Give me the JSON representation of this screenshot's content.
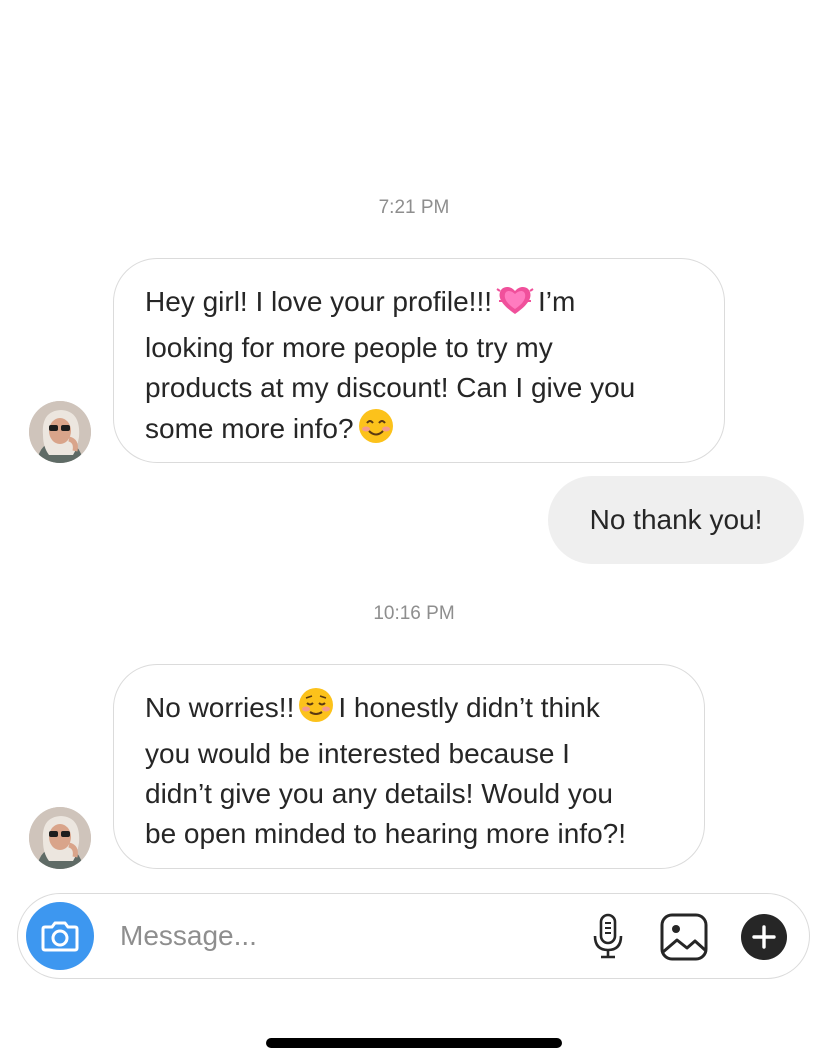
{
  "conversation": {
    "messages": [
      {
        "type": "timestamp",
        "text": "7:21 PM"
      },
      {
        "type": "incoming",
        "lines": [
          "Hey girl! I love your profile!!!",
          "I’m",
          "looking for more people to try my",
          "products at my discount! Can I give you",
          "some more info?"
        ],
        "emojis": [
          "growing-heart-emoji",
          "smiling-face-emoji"
        ]
      },
      {
        "type": "outgoing",
        "text": "No thank you!"
      },
      {
        "type": "timestamp",
        "text": "10:16 PM"
      },
      {
        "type": "incoming",
        "lines": [
          "No worries!!",
          "I honestly didn’t think",
          "you would be interested because I",
          "didn’t give you any details! Would you",
          "be open minded to hearing more info?!"
        ],
        "emojis": [
          "relieved-smiling-face-emoji"
        ]
      }
    ]
  },
  "composer": {
    "placeholder": "Message...",
    "icons": [
      "camera-icon",
      "microphone-icon",
      "gallery-icon",
      "plus-icon"
    ],
    "camera_color": "#3d97f0"
  },
  "colors": {
    "outgoing_bubble": "#efefef",
    "incoming_border": "#dbdbdb",
    "timestamp": "#8e8e8e"
  }
}
